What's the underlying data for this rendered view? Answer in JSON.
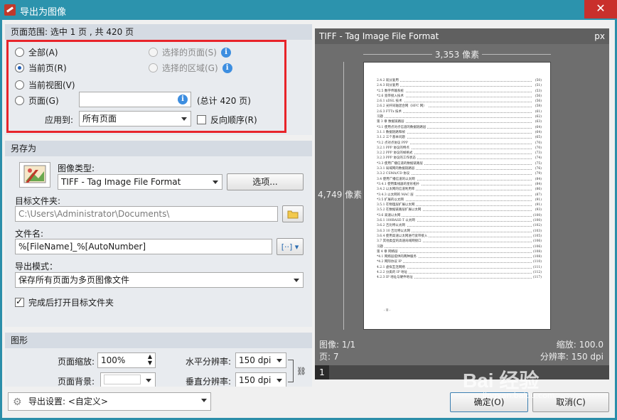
{
  "window": {
    "title": "导出为图像",
    "close": "✕"
  },
  "range": {
    "header": "页面范围: 选中 1 页 , 共 420 页",
    "all": "全部(A)",
    "current_page": "当前页(R)",
    "current_view": "当前视图(V)",
    "pages": "页面(G)",
    "selected_pages": "选择的页面(S)",
    "selected_area": "选择的区域(G)",
    "total": "(总计 420 页)",
    "apply_to_label": "应用到:",
    "apply_to_value": "所有页面",
    "reverse_order": "反向顺序(R)",
    "selected": "current_page"
  },
  "saveas": {
    "header": "另存为",
    "image_type_label": "图像类型:",
    "image_type_value": "TIFF - Tag Image File Format",
    "options_button": "选项...",
    "target_folder_label": "目标文件夹:",
    "target_folder_value": "C:\\Users\\Administrator\\Documents\\",
    "filename_label": "文件名:",
    "filename_value": "%[FileName]_%[AutoNumber]",
    "export_mode_label": "导出模式：",
    "export_mode_value": "保存所有页面为多页图像文件",
    "open_folder": "完成后打开目标文件夹"
  },
  "graphics": {
    "header": "图形",
    "zoom_label": "页面缩放:",
    "zoom_value": "100%",
    "bg_label": "页面背景:",
    "hres_label": "水平分辨率:",
    "hres_value": "150 dpi",
    "vres_label": "垂直分辨率:",
    "vres_value": "150 dpi"
  },
  "preview": {
    "format": "TIFF - Tag Image File Format",
    "unit": "px",
    "width": "3,353 像素",
    "height": "4,749 像素",
    "image": "图像: 1/1",
    "page": "页: 7",
    "zoom": "缩放: 100.0",
    "resolution": "分辨率: 150 dpi",
    "page_number": "1",
    "toc": [
      {
        "t": "2.4.2  就分复用",
        "p": "(50)"
      },
      {
        "t": "2.4.3  码分复用",
        "p": "(51)"
      },
      {
        "t": "*2.5  数字传输系统",
        "p": "(53)"
      },
      {
        "t": "*2.6  宽带接入技术",
        "p": "(56)"
      },
      {
        "t": "2.6.1  xDSL 技术",
        "p": "(56)"
      },
      {
        "t": "2.6.2  光纤同轴混合网（HFC 网）",
        "p": "(58)"
      },
      {
        "t": "2.6.3  FTTx 技术",
        "p": "(61)"
      },
      {
        "t": "习题",
        "p": "(62)"
      },
      {
        "t": "第 3 章  数据链路层",
        "p": "(63)"
      },
      {
        "t": "*3.1  使用点对点信道的数据链路层",
        "p": "(64)"
      },
      {
        "t": "3.1.1  数据链路和帧",
        "p": "(64)"
      },
      {
        "t": "3.1.2  三个基本问题",
        "p": "(65)"
      },
      {
        "t": "*3.2  点对点协议 PPP",
        "p": "(70)"
      },
      {
        "t": "3.2.1  PPP 协议的特点",
        "p": "(70)"
      },
      {
        "t": "3.2.2  PPP 协议的帧格式",
        "p": "(73)"
      },
      {
        "t": "3.2.3  PPP 协议的工作状态",
        "p": "(74)"
      },
      {
        "t": "*3.3  使用广播信道的数据链路层",
        "p": "(75)"
      },
      {
        "t": "3.3.1  局域网的数据链路层",
        "p": "(76)"
      },
      {
        "t": "3.3.2  CSMA/CD 协议",
        "p": "(79)"
      },
      {
        "t": "3.4  使用广播信道的以太网",
        "p": "(84)"
      },
      {
        "t": "*3.4.1  使用集线器的星形拓扑",
        "p": "(84)"
      },
      {
        "t": "3.4.2  以太网的信道利用率",
        "p": "(86)"
      },
      {
        "t": "*3.4.3  以太网的 MAC 层",
        "p": "(87)"
      },
      {
        "t": "*3.5  扩展的以太网",
        "p": "(91)"
      },
      {
        "t": "3.5.1  在物理层扩展以太网",
        "p": "(91)"
      },
      {
        "t": "3.5.2  在数据链路层扩展以太网",
        "p": "(93)"
      },
      {
        "t": "*3.6  高速以太网",
        "p": "(100)"
      },
      {
        "t": "3.6.1  100BASE-T 以太网",
        "p": "(100)"
      },
      {
        "t": "3.6.2  吉比特以太网",
        "p": "(102)"
      },
      {
        "t": "3.6.3  10 吉比特以太网",
        "p": "(103)"
      },
      {
        "t": "3.6.4  使用高速以太网进行宽带接入",
        "p": "(105)"
      },
      {
        "t": "3.7  其他类型的高速局域网接口",
        "p": "(106)"
      },
      {
        "t": "习题",
        "p": "(106)"
      },
      {
        "t": "第 4 章  网络层",
        "p": "(108)"
      },
      {
        "t": "*4.1  网络层提供的两种服务",
        "p": "(108)"
      },
      {
        "t": "*4.2  网际协议 IP",
        "p": "(110)"
      },
      {
        "t": "4.2.1  虚拟互连网络",
        "p": "(111)"
      },
      {
        "t": "4.2.2  分类的 IP 地址",
        "p": "(112)"
      },
      {
        "t": "4.2.3  IP 地址与硬件地址",
        "p": "(117)"
      }
    ],
    "footer": "· II ·"
  },
  "bottom": {
    "settings": "导出设置: <自定义>",
    "ok": "确定(O)",
    "cancel": "取消(C)"
  },
  "watermark": {
    "text": "Bai 经验",
    "sub": "jingyan.baidu.com"
  }
}
